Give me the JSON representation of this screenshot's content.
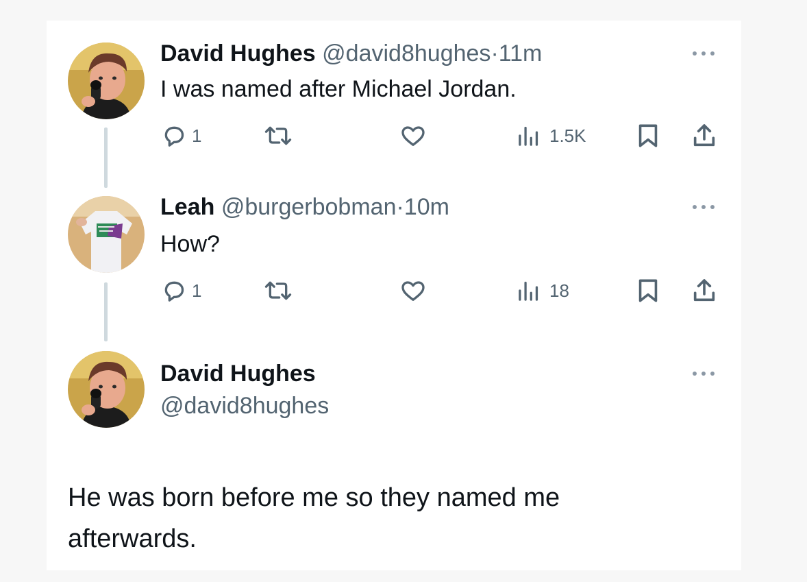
{
  "tweets": [
    {
      "name": "David Hughes",
      "handle": "@david8hughes",
      "separator": "·",
      "time": "11m",
      "text": "I was named after Michael Jordan.",
      "reply_count": "1",
      "views": "1.5K",
      "avatar_icon": "person-avatar"
    },
    {
      "name": "Leah",
      "handle": "@burgerbobman",
      "separator": "·",
      "time": "10m",
      "text": "How?",
      "reply_count": "1",
      "views": "18",
      "avatar_icon": "person-avatar"
    }
  ],
  "main_tweet": {
    "name": "David Hughes",
    "handle": "@david8hughes",
    "text_line1": "He was born before me so they named me",
    "text_line2": "afterwards."
  },
  "colors": {
    "page_background": "#f7f7f7",
    "card_background": "#ffffff",
    "text_primary": "#0f1419",
    "text_secondary": "#536471",
    "thread_line": "#cfd9de"
  },
  "icons": [
    "reply-icon",
    "retweet-icon",
    "like-icon",
    "views-icon",
    "bookmark-icon",
    "share-icon",
    "more-icon"
  ]
}
